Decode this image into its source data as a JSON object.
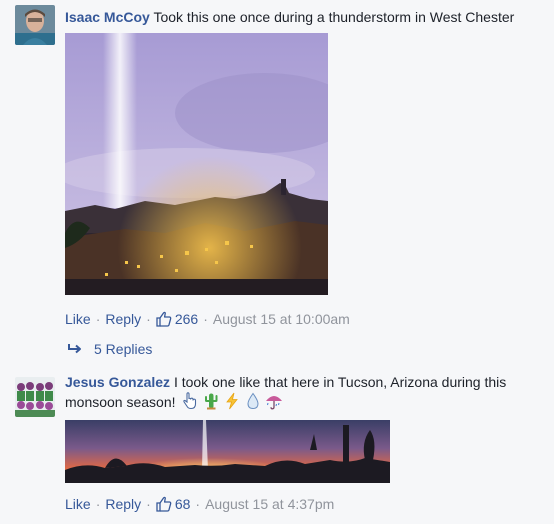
{
  "comments": [
    {
      "author": "Isaac McCoy",
      "text": "Took this one once during a thunderstorm in West Chester",
      "actions": {
        "like_label": "Like",
        "reply_label": "Reply",
        "like_count": "266",
        "timestamp": "August 15 at 10:00am"
      },
      "replies_label": "5 Replies"
    },
    {
      "author": "Jesus Gonzalez",
      "text": "I took one like that here in Tucson, Arizona during this monsoon season!",
      "emojis": [
        "hand-pointing-icon",
        "cactus-icon",
        "lightning-icon",
        "droplet-icon",
        "umbrella-icon"
      ],
      "actions": {
        "like_label": "Like",
        "reply_label": "Reply",
        "like_count": "68",
        "timestamp": "August 15 at 4:37pm"
      }
    }
  ],
  "colors": {
    "background": "#f6f7f9",
    "link": "#365899",
    "meta": "#90949c",
    "text": "#1d2129"
  }
}
